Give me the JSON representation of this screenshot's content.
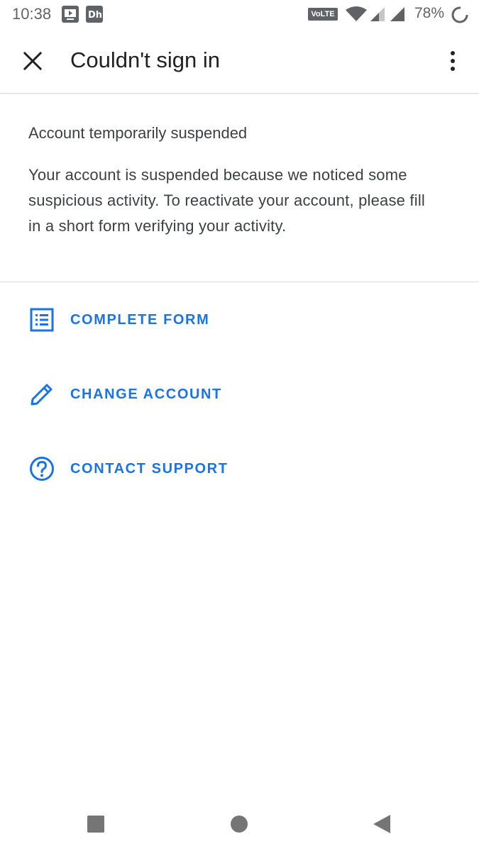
{
  "status_bar": {
    "time": "10:38",
    "network_badge": "VoLTE",
    "battery": "78%"
  },
  "app_bar": {
    "title": "Couldn't sign in"
  },
  "content": {
    "heading": "Account temporarily suspended",
    "body": "Your account is suspended because we noticed some suspicious activity. To reactivate your account, please fill in a short form verifying your activity."
  },
  "actions": [
    {
      "label": "COMPLETE FORM",
      "icon": "form-list-icon"
    },
    {
      "label": "CHANGE ACCOUNT",
      "icon": "pencil-icon"
    },
    {
      "label": "CONTACT SUPPORT",
      "icon": "help-circle-icon"
    }
  ],
  "colors": {
    "accent": "#1a73e8",
    "text_primary": "#202124",
    "text_secondary": "#3c4043",
    "status_gray": "#5f6368",
    "divider": "#dadce0"
  }
}
